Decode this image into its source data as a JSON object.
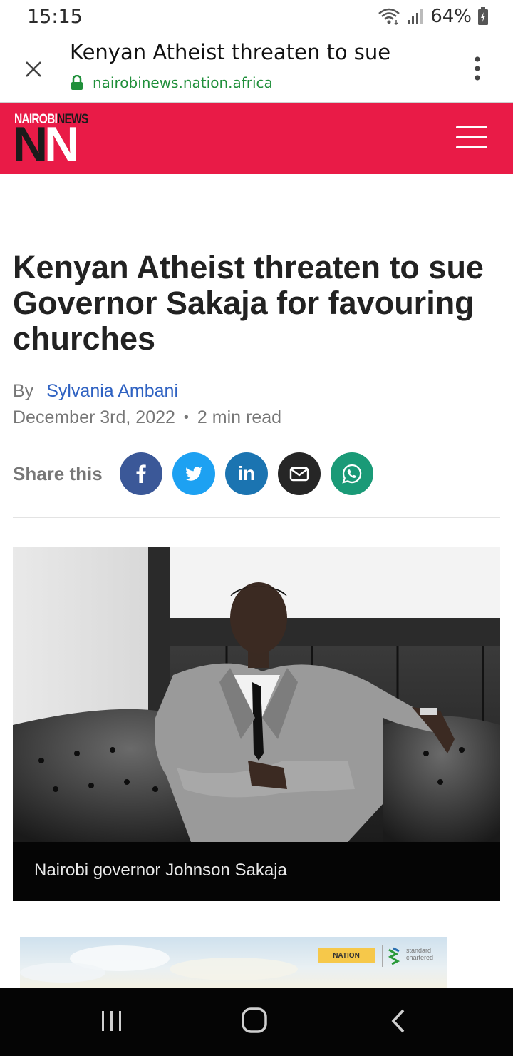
{
  "status_bar": {
    "time": "15:15",
    "battery": "64%",
    "icons": [
      "wifi-icon",
      "signal-icon",
      "battery-charging-icon"
    ]
  },
  "custom_tab": {
    "title": "Kenyan Atheist threaten to sue",
    "url": "nairobinews.nation.africa",
    "icons": [
      "close-icon",
      "lock-icon",
      "more-vert-icon"
    ]
  },
  "site_header": {
    "logo_top_left": "NAIROBI",
    "logo_top_right": "NEWS",
    "logo_mark_left": "N",
    "logo_mark_right": "N",
    "brand_color": "#e91b47",
    "icons": [
      "hamburger-menu-icon"
    ]
  },
  "article": {
    "headline": "Kenyan Atheist threaten to sue Governor Sakaja for favouring churches",
    "by_label": "By",
    "author": "Sylvania Ambani",
    "date": "December 3rd, 2022",
    "separator": "•",
    "read_time": "2 min read",
    "share_label": "Share this",
    "share_buttons": [
      {
        "name": "facebook",
        "color": "#3b5898"
      },
      {
        "name": "twitter",
        "color": "#1da1f2"
      },
      {
        "name": "linkedin",
        "glyph": "in",
        "color": "#1b74b1"
      },
      {
        "name": "email",
        "color": "#262626"
      },
      {
        "name": "whatsapp",
        "color": "#1a9a77"
      }
    ],
    "photo_caption": "Nairobi governor Johnson Sakaja"
  },
  "ad": {
    "badge": "NATION",
    "partner": "standard chartered"
  },
  "nav_bar": {
    "icons": [
      "recents-icon",
      "home-icon",
      "back-icon"
    ]
  }
}
